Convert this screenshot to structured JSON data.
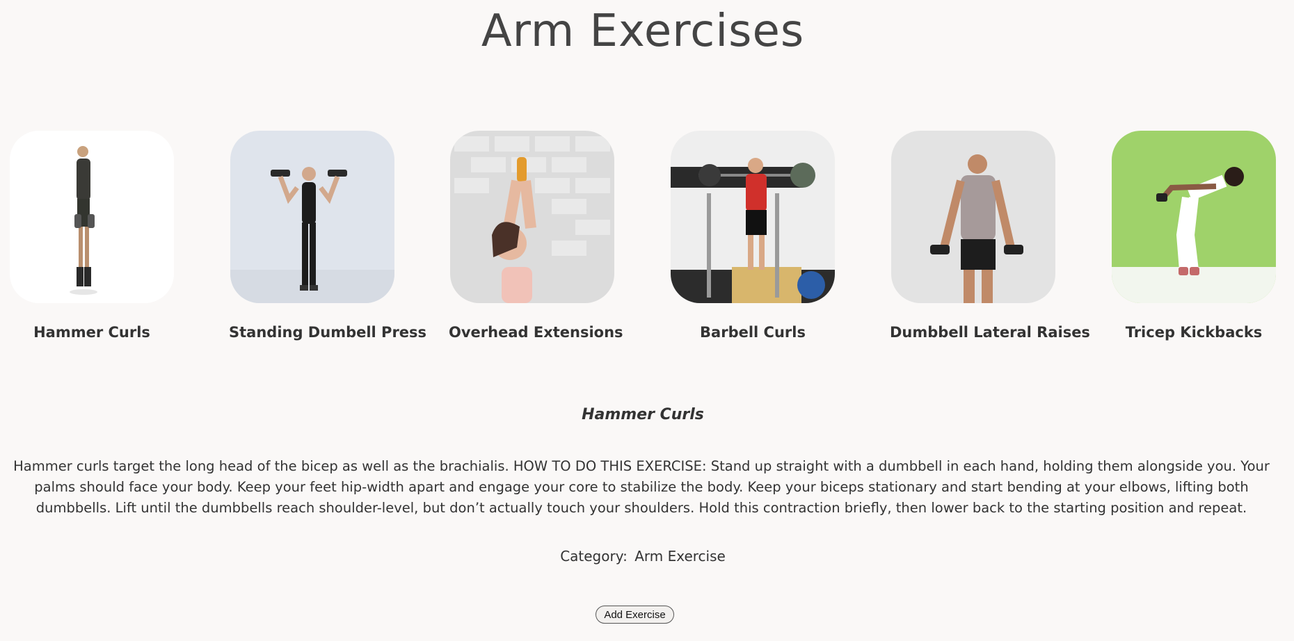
{
  "page": {
    "title": "Arm Exercises"
  },
  "exercises": [
    {
      "name": "Hammer Curls"
    },
    {
      "name": "Standing Dumbell Press"
    },
    {
      "name": "Overhead Extensions"
    },
    {
      "name": "Barbell Curls"
    },
    {
      "name": "Dumbbell Lateral Raises"
    },
    {
      "name": "Tricep Kickbacks"
    }
  ],
  "detail": {
    "title": "Hammer Curls",
    "description": "Hammer curls target the long head of the bicep as well as the brachialis. HOW TO DO THIS EXERCISE: Stand up straight with a dumbbell in each hand, holding them alongside you. Your palms should face your body. Keep your feet hip-width apart and engage your core to stabilize the body. Keep your biceps stationary and start bending at your elbows, lifting both dumbbells. Lift until the dumbbells reach shoulder-level, but don’t actually touch your shoulders. Hold this contraction briefly, then lower back to the starting position and repeat.",
    "category_label": "Category:",
    "category_value": "Arm Exercise"
  },
  "actions": {
    "add_label": "Add Exercise"
  },
  "colors": {
    "background": "#faf8f7",
    "text": "#333333",
    "kickback_bg": "#9fd26a"
  }
}
